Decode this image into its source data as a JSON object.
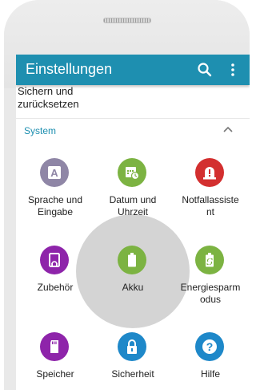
{
  "appbar": {
    "title": "Einstellungen"
  },
  "previous_item": {
    "line1": "Sichern und",
    "line2": "zurücksetzen"
  },
  "section": {
    "label": "System"
  },
  "tiles": [
    {
      "line1": "Sprache und",
      "line2": "Eingabe",
      "color": "#8f86a6",
      "icon": "keyboard-a-icon"
    },
    {
      "line1": "Datum und",
      "line2": "Uhrzeit",
      "color": "#7cb342",
      "icon": "calendar-clock-icon"
    },
    {
      "line1": "Notfallassiste",
      "line2": "nt",
      "color": "#d32f2f",
      "icon": "emergency-alert-icon"
    },
    {
      "line1": "Zubehör",
      "line2": "",
      "color": "#8e24aa",
      "icon": "headset-accessory-icon"
    },
    {
      "line1": "Akku",
      "line2": "",
      "color": "#7cb342",
      "icon": "battery-icon"
    },
    {
      "line1": "Energiesparm",
      "line2": "odus",
      "color": "#7cb342",
      "icon": "power-saving-icon"
    },
    {
      "line1": "Speicher",
      "line2": "",
      "color": "#8e24aa",
      "icon": "storage-card-icon"
    },
    {
      "line1": "Sicherheit",
      "line2": "",
      "color": "#1e88c9",
      "icon": "lock-icon"
    },
    {
      "line1": "Hilfe",
      "line2": "",
      "color": "#1e88c9",
      "icon": "help-question-icon"
    }
  ]
}
